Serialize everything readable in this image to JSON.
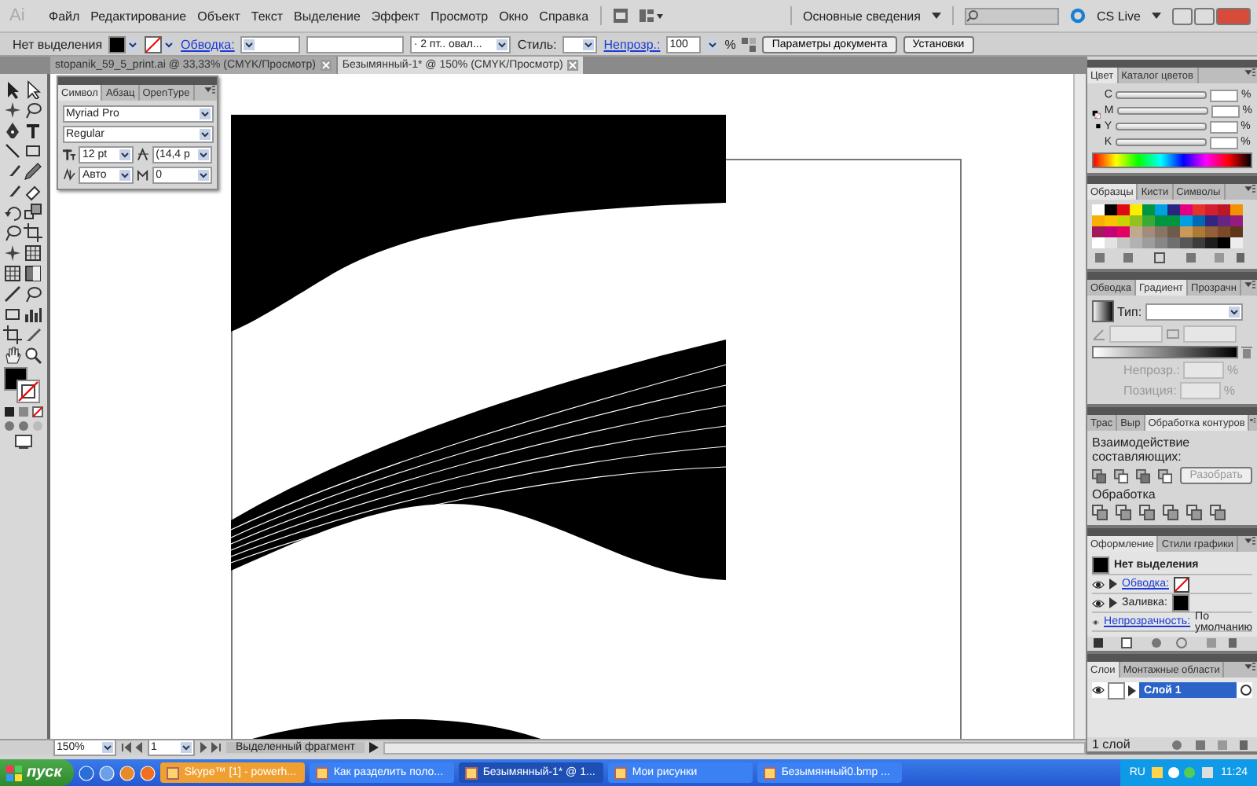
{
  "app": {
    "logo": "Ai"
  },
  "menu": [
    "Файл",
    "Редактирование",
    "Объект",
    "Текст",
    "Выделение",
    "Эффект",
    "Просмотр",
    "Окно",
    "Справка"
  ],
  "workspace": {
    "label": "Основные сведения",
    "cs_live": "CS Live"
  },
  "control_bar": {
    "selection": "Нет выделения",
    "stroke_link": "Обводка:",
    "brush": "· 2 пт.. овал...",
    "style_label": "Стиль:",
    "opacity_link": "Непрозр.:",
    "opacity_value": "100",
    "percent": "%",
    "buttons": [
      "Параметры документа",
      "Установки"
    ]
  },
  "doc_tabs": [
    {
      "label": "stopanik_59_5_print.ai @ 33,33% (CMYK/Просмотр)",
      "selected": false
    },
    {
      "label": "Безымянный-1* @ 150% (CMYK/Просмотр)",
      "selected": true
    }
  ],
  "character_panel": {
    "tabs": [
      {
        "label": "Символ",
        "selected": true
      },
      {
        "label": "Абзац",
        "selected": false
      },
      {
        "label": "OpenType",
        "selected": false
      }
    ],
    "font": "Myriad Pro",
    "style": "Regular",
    "size": "12 pt",
    "leading": "(14,4 p",
    "kerning": "Авто",
    "tracking": "0"
  },
  "color_panel": {
    "tabs": [
      {
        "label": "Цвет",
        "selected": true
      },
      {
        "label": "Каталог цветов",
        "selected": false
      }
    ],
    "channels": [
      {
        "label": "C",
        "unit": "%"
      },
      {
        "label": "M",
        "unit": "%"
      },
      {
        "label": "Y",
        "unit": "%"
      },
      {
        "label": "K",
        "unit": "%"
      }
    ]
  },
  "swatches_panel": {
    "tabs": [
      {
        "label": "Образцы",
        "selected": true
      },
      {
        "label": "Кисти",
        "selected": false
      },
      {
        "label": "Символы",
        "selected": false
      }
    ],
    "swatches": [
      {
        "color": "#ffffff"
      },
      {
        "color": "#000000"
      },
      {
        "color": "#e30613"
      },
      {
        "color": "#ffed00"
      },
      {
        "color": "#009640"
      },
      {
        "color": "#00a0e3"
      },
      {
        "color": "#2a2483"
      },
      {
        "color": "#e5007d"
      },
      {
        "color": "#e6332a"
      },
      {
        "color": "#d51e2e"
      },
      {
        "color": "#be1622"
      },
      {
        "color": "#f39200"
      },
      {
        "color": "#f9b000"
      },
      {
        "color": "#fdc300"
      },
      {
        "color": "#c8d400"
      },
      {
        "color": "#95c11f"
      },
      {
        "color": "#3aaa35"
      },
      {
        "color": "#009640"
      },
      {
        "color": "#00963f"
      },
      {
        "color": "#009fe3"
      },
      {
        "color": "#0069b4"
      },
      {
        "color": "#312783"
      },
      {
        "color": "#662483"
      },
      {
        "color": "#951b81"
      },
      {
        "color": "#a2195b"
      },
      {
        "color": "#c4007a"
      },
      {
        "color": "#e50064"
      },
      {
        "color": "#c0a98e"
      },
      {
        "color": "#a58c7a"
      },
      {
        "color": "#8a7565"
      },
      {
        "color": "#6f5a4b"
      },
      {
        "color": "#c9995a"
      },
      {
        "color": "#ad7a33"
      },
      {
        "color": "#936037"
      },
      {
        "color": "#7b4a27"
      },
      {
        "color": "#5e3719"
      },
      {
        "color": "#ffffff"
      },
      {
        "color": "#e3e3e3"
      },
      {
        "color": "#c6c6c6"
      },
      {
        "color": "#b2b2b2"
      },
      {
        "color": "#9d9d9c"
      },
      {
        "color": "#878787"
      },
      {
        "color": "#706f6f"
      },
      {
        "color": "#575756"
      },
      {
        "color": "#3c3c3b"
      },
      {
        "color": "#1d1d1b"
      },
      {
        "color": "#000000"
      },
      {
        "color": "#ededed"
      }
    ]
  },
  "gradient_panel": {
    "tabs": [
      {
        "label": "Обводка",
        "selected": false
      },
      {
        "label": "Градиент",
        "selected": true
      },
      {
        "label": "Прозрачн",
        "selected": false
      }
    ],
    "type_label": "Тип:",
    "opacity_label": "Непрозр.:",
    "location_label": "Позиция:",
    "percent": "%"
  },
  "pathfinder_panel": {
    "tabs": [
      {
        "label": "Трас",
        "selected": false
      },
      {
        "label": "Выр",
        "selected": false
      },
      {
        "label": "Обработка контуров",
        "selected": true
      }
    ],
    "shape_modes_label": "Взаимодействие составляющих:",
    "expand_button": "Разобрать",
    "pathfinders_label": "Обработка"
  },
  "appearance_panel": {
    "tabs": [
      {
        "label": "Оформление",
        "selected": true
      },
      {
        "label": "Стили графики",
        "selected": false
      }
    ],
    "header": "Нет выделения",
    "rows": [
      {
        "kind": "stroke",
        "label": "Обводка:"
      },
      {
        "kind": "fill",
        "label": "Заливка:"
      },
      {
        "kind": "opacity",
        "label": "Непрозрачность:",
        "value": "По умолчанию"
      }
    ]
  },
  "layers_panel": {
    "tabs": [
      {
        "label": "Слои",
        "selected": true
      },
      {
        "label": "Монтажные области",
        "selected": false
      }
    ],
    "layers": [
      {
        "name": "Слой 1",
        "selected": true
      }
    ],
    "count": "1 слой"
  },
  "status_bar": {
    "zoom": "150%",
    "page": "1",
    "info": "Выделенный фрагмент"
  },
  "taskbar": {
    "start": "пуск",
    "tasks": [
      {
        "label": "Skype™ [1] - powerh...",
        "selected": false,
        "flashing": true
      },
      {
        "label": "Как разделить поло...",
        "selected": false,
        "flashing": false
      },
      {
        "label": "Безымянный-1* @ 1...",
        "selected": true,
        "flashing": false
      },
      {
        "label": "Мои рисунки",
        "selected": false,
        "flashing": false
      },
      {
        "label": "Безымянный0.bmp ...",
        "selected": false,
        "flashing": false
      }
    ],
    "language": "RU",
    "clock": "11:24"
  }
}
